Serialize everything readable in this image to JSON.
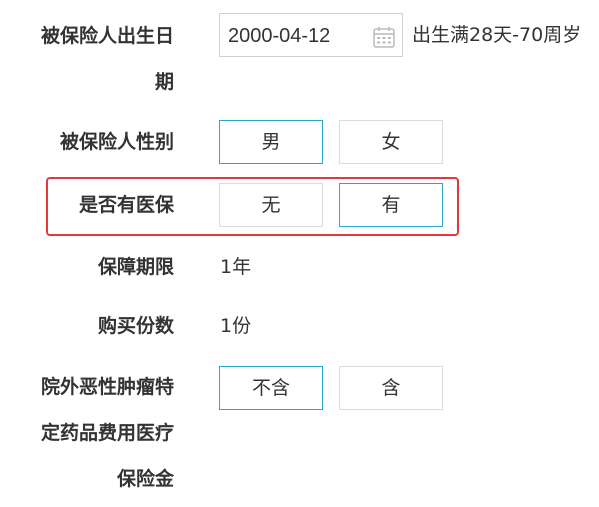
{
  "birthdate": {
    "label_line1": "被保险人出生日",
    "label_line2": "期",
    "value": "2000-04-12",
    "hint": "出生满28天-70周岁"
  },
  "gender": {
    "label": "被保险人性别",
    "options": [
      "男",
      "女"
    ],
    "selected": "男"
  },
  "medical_insurance": {
    "label": "是否有医保",
    "options": [
      "无",
      "有"
    ],
    "selected": "有",
    "highlight_color": "#e4393c"
  },
  "coverage_period": {
    "label": "保障期限",
    "value": "1年"
  },
  "purchase_quantity": {
    "label": "购买份数",
    "value": "1份"
  },
  "outpatient_drug": {
    "label_line1": "院外恶性肿瘤特",
    "label_line2": "定药品费用医疗",
    "label_line3": "保险金",
    "options": [
      "不含",
      "含"
    ],
    "selected": "不含"
  },
  "colors": {
    "selected_border": "#29a8c6",
    "default_border": "#dcdcdc",
    "text": "#333333"
  },
  "icons": {
    "date_picker": "calendar-icon"
  }
}
